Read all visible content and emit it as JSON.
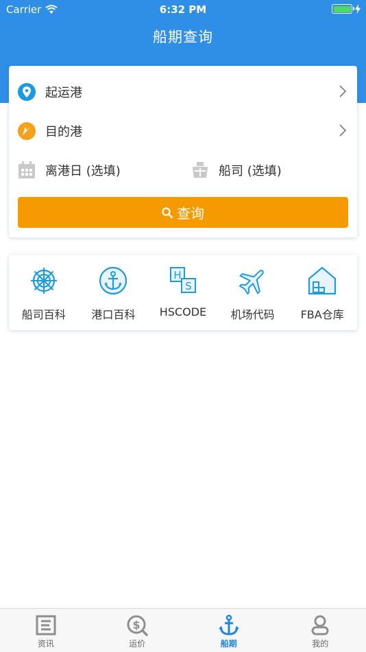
{
  "status_bar": {
    "carrier": "Carrier",
    "time": "6:32 PM"
  },
  "nav": {
    "title": "船期查询"
  },
  "search": {
    "origin_label": "起运港",
    "destination_label": "目的港",
    "departure_label": "离港日 (选填)",
    "carrier_label": "船司 (选填)",
    "button_label": "查询"
  },
  "tools": [
    {
      "label": "船司百科",
      "icon": "ship-wheel-icon"
    },
    {
      "label": "港口百科",
      "icon": "anchor-icon"
    },
    {
      "label": "HSCODE",
      "icon": "hs-code-icon"
    },
    {
      "label": "机场代码",
      "icon": "airplane-icon"
    },
    {
      "label": "FBA仓库",
      "icon": "warehouse-icon"
    }
  ],
  "tabbar": {
    "tabs": [
      {
        "label": "资讯",
        "icon": "news-icon"
      },
      {
        "label": "运价",
        "icon": "price-icon"
      },
      {
        "label": "船期",
        "icon": "anchor-icon",
        "active": true
      },
      {
        "label": "我的",
        "icon": "profile-icon"
      }
    ]
  },
  "colors": {
    "header": "#2f8ee6",
    "accent_button": "#f59a00",
    "tool_icon": "#1f9ae0",
    "tab_active": "#1f85e5",
    "tab_inactive": "#8e8e8e"
  }
}
